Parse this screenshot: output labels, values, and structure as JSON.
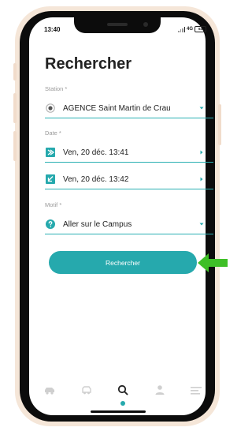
{
  "status_bar": {
    "time": "13:40",
    "network": "4G",
    "battery": "64"
  },
  "page": {
    "title": "Rechercher"
  },
  "form": {
    "station": {
      "label": "Station *",
      "value": "AGENCE Saint Martin de Crau",
      "icon": "radio-button-icon"
    },
    "date": {
      "label": "Date *",
      "departure": {
        "value": "Ven, 20 déc. 13:41",
        "icon": "departure-arrow-icon"
      },
      "return": {
        "value": "Ven, 20 déc. 13:42",
        "icon": "return-arrow-icon"
      }
    },
    "motif": {
      "label": "Motif *",
      "value": "Aller sur le Campus",
      "icon": "help-circle-icon"
    }
  },
  "actions": {
    "search_label": "Rechercher"
  },
  "tabbar": {
    "items": [
      {
        "icon": "car-icon",
        "active": false
      },
      {
        "icon": "vehicle-outline-icon",
        "active": false
      },
      {
        "icon": "search-icon",
        "active": true
      },
      {
        "icon": "person-icon",
        "active": false
      },
      {
        "icon": "menu-icon",
        "active": false
      }
    ]
  },
  "colors": {
    "accent": "#26a9ad",
    "text": "#222222",
    "label": "#9a9a9a",
    "frame": "#0c0c0c",
    "case": "#f5e6d8",
    "annotation_arrow": "#3fbf27"
  }
}
